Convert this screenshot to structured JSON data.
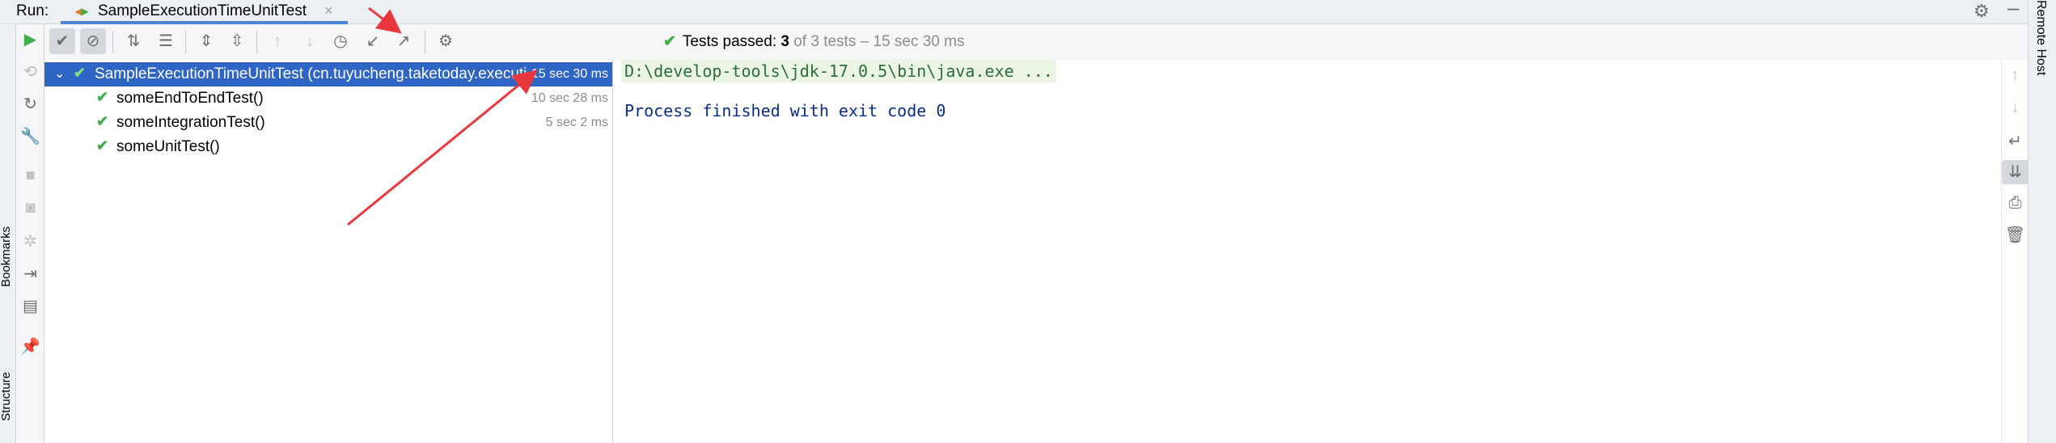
{
  "run_bar": {
    "label": "Run:",
    "tab_title": "SampleExecutionTimeUnitTest",
    "tab_close": "×",
    "settings_icon": "gear-icon",
    "minimize_icon": "minimize-icon"
  },
  "right_strip": {
    "text": "Remote Host"
  },
  "left_strip": {
    "items": [
      "Bookmarks",
      "Structure"
    ]
  },
  "status": {
    "check": "✔",
    "prefix": "Tests passed:",
    "passed": "3",
    "of_total": "of 3 tests",
    "sep": "–",
    "duration": "15 sec 30 ms"
  },
  "tree": {
    "root": {
      "label": "SampleExecutionTimeUnitTest (cn.tuyucheng.taketoday.executiontime)",
      "time": "15 sec 30 ms"
    },
    "children": [
      {
        "label": "someEndToEndTest()",
        "time": "10 sec 28 ms"
      },
      {
        "label": "someIntegrationTest()",
        "time": "5 sec 2 ms"
      },
      {
        "label": "someUnitTest()",
        "time": ""
      }
    ]
  },
  "console": {
    "command": "D:\\develop-tools\\jdk-17.0.5\\bin\\java.exe ...",
    "process_finished": "Process finished with exit code 0"
  },
  "colors": {
    "selection": "#2f66c6",
    "pass_green": "#3fae4b",
    "annotation_red": "#e8383d",
    "tab_accent": "#4a84d6"
  }
}
